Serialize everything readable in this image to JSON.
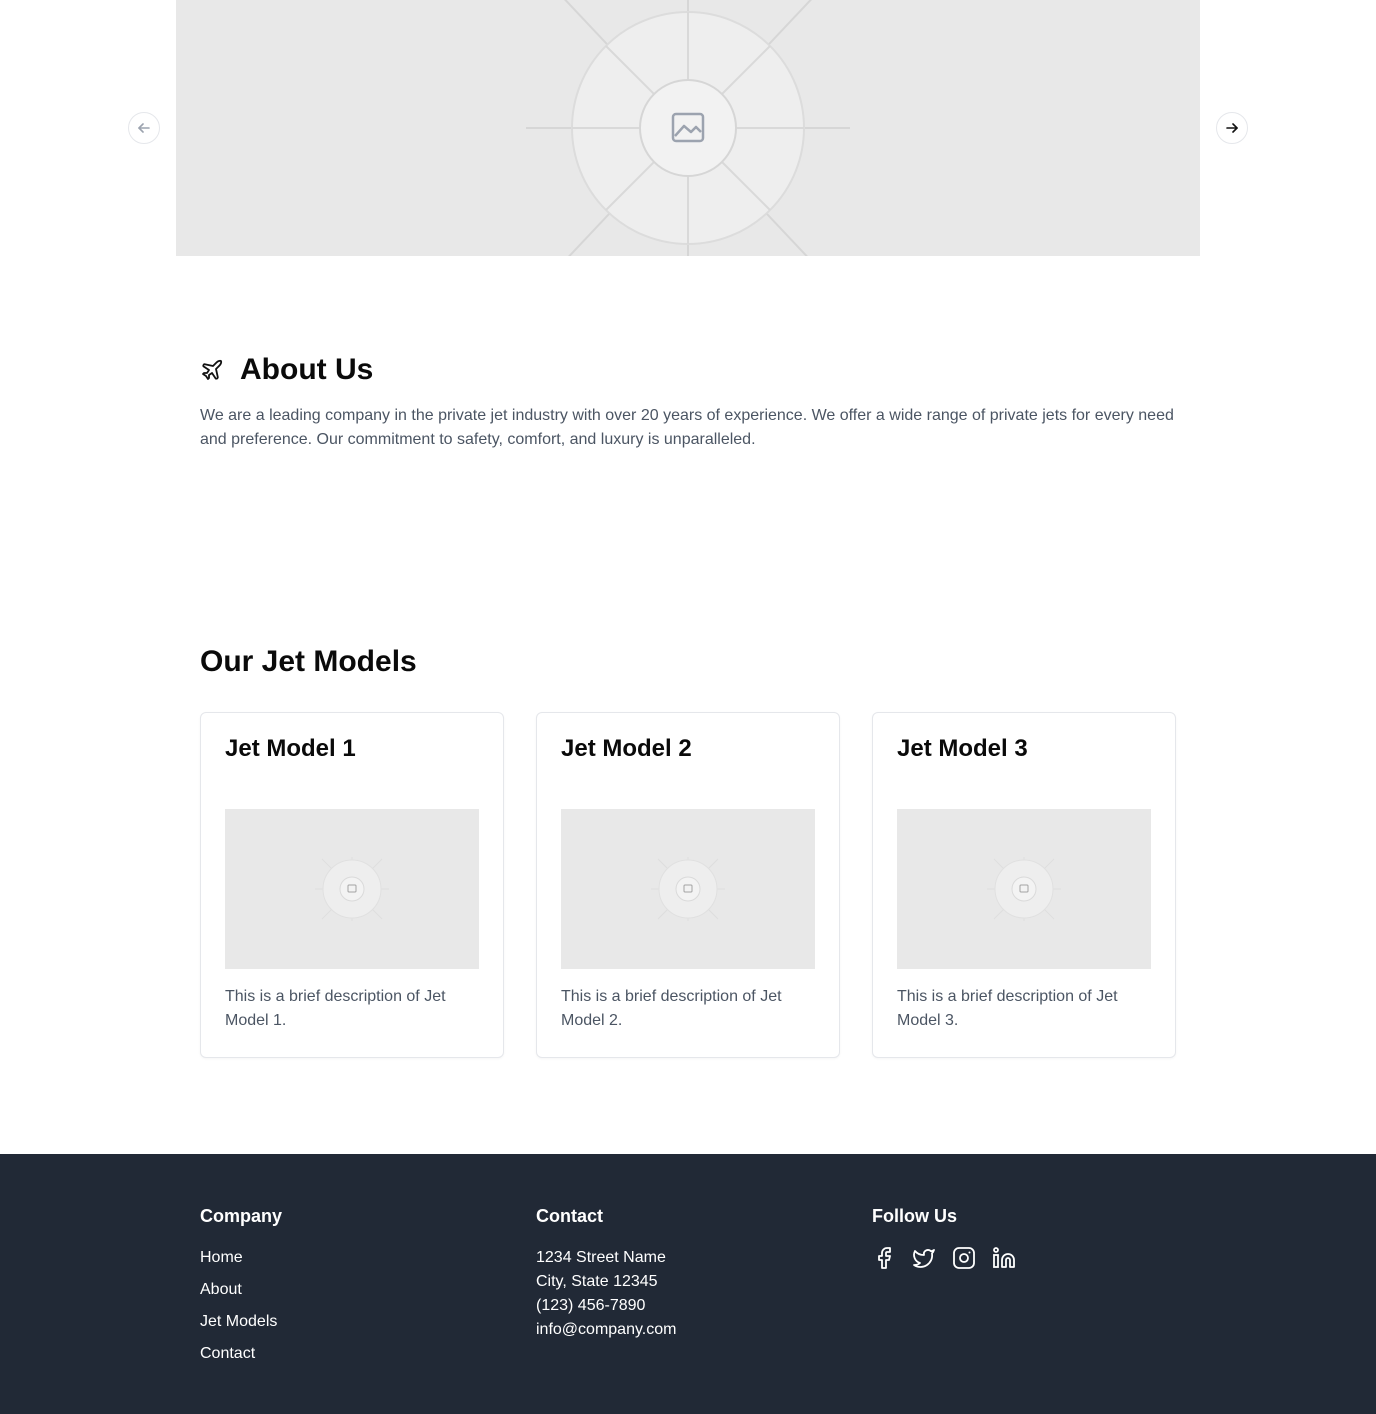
{
  "carousel": {
    "prev_icon": "arrow-left-icon",
    "next_icon": "arrow-right-icon",
    "image_icon": "image-placeholder-icon"
  },
  "about": {
    "icon": "plane-icon",
    "title": "About Us",
    "text": "We are a leading company in the private jet industry with over 20 years of experience. We offer a wide range of private jets for every need and preference. Our commitment to safety, comfort, and luxury is unparalleled."
  },
  "models": {
    "title": "Our Jet Models",
    "items": [
      {
        "title": "Jet Model 1",
        "description": "This is a brief description of Jet Model 1."
      },
      {
        "title": "Jet Model 2",
        "description": "This is a brief description of Jet Model 2."
      },
      {
        "title": "Jet Model 3",
        "description": "This is a brief description of Jet Model 3."
      }
    ]
  },
  "footer": {
    "company": {
      "heading": "Company",
      "links": [
        "Home",
        "About",
        "Jet Models",
        "Contact"
      ]
    },
    "contact": {
      "heading": "Contact",
      "address_line1": "1234 Street Name",
      "address_line2": "City, State 12345",
      "phone": "(123) 456-7890",
      "email": "info@company.com"
    },
    "follow": {
      "heading": "Follow Us",
      "icons": [
        "facebook-icon",
        "twitter-icon",
        "instagram-icon",
        "linkedin-icon"
      ]
    }
  },
  "colors": {
    "footer_bg": "#212936",
    "body_text": "#4b5563",
    "placeholder_bg": "#e8e8e8"
  }
}
